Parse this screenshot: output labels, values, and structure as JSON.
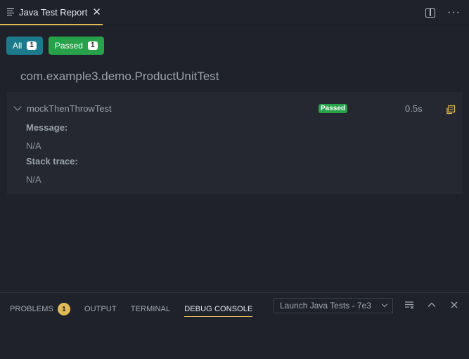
{
  "tab": {
    "title": "Java Test Report",
    "close": "✕"
  },
  "filters": {
    "all_label": "All",
    "all_count": "1",
    "passed_label": "Passed",
    "passed_count": "1"
  },
  "suite": {
    "title": "com.example3.demo.ProductUnitTest",
    "tests": [
      {
        "name": "mockThenThrowTest",
        "status": "Passed",
        "duration": "0.5s",
        "message_label": "Message:",
        "message_value": "N/A",
        "stack_label": "Stack trace:",
        "stack_value": "N/A"
      }
    ]
  },
  "panel": {
    "tabs": [
      {
        "label": "PROBLEMS",
        "badge": "1"
      },
      {
        "label": "OUTPUT"
      },
      {
        "label": "TERMINAL"
      },
      {
        "label": "DEBUG CONSOLE"
      }
    ],
    "launch_config": "Launch Java Tests - 7e3"
  },
  "icons": {
    "tab": "list-icon",
    "split": "split-editor-icon",
    "more": "more-actions-icon",
    "copy": "copy-icon",
    "clear": "clear-console-icon",
    "maximize": "chevron-up-icon",
    "close_panel": "close-icon"
  },
  "colors": {
    "accent": "#e2b957",
    "all_filter": "#1d7a8c",
    "passed": "#27a24a",
    "background": "#1f222a"
  }
}
